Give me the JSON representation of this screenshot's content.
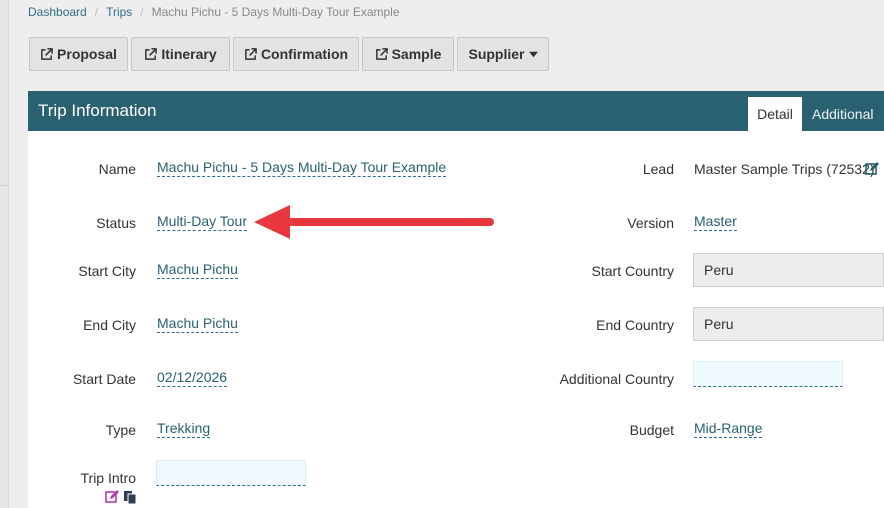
{
  "breadcrumb": {
    "items": [
      "Dashboard",
      "Trips",
      "Machu Pichu - 5 Days Multi-Day Tour Example"
    ]
  },
  "toolbar": {
    "proposal_label": "Proposal",
    "itinerary_label": "Itinerary",
    "confirmation_label": "Confirmation",
    "sample_label": "Sample",
    "supplier_label": "Supplier"
  },
  "panel": {
    "title": "Trip Information",
    "tabs": [
      "Detail",
      "Additional"
    ],
    "active_tab": "Detail",
    "header_color": "#2a6170"
  },
  "fields": {
    "name": {
      "label": "Name",
      "value": "Machu Pichu - 5 Days Multi-Day Tour Example"
    },
    "status": {
      "label": "Status",
      "value": "Multi-Day Tour"
    },
    "start_city": {
      "label": "Start City",
      "value": "Machu Pichu"
    },
    "end_city": {
      "label": "End City",
      "value": "Machu Pichu"
    },
    "start_date": {
      "label": "Start Date",
      "value": "02/12/2026"
    },
    "type": {
      "label": "Type",
      "value": "Trekking"
    },
    "trip_intro": {
      "label": "Trip Intro",
      "value": ""
    },
    "lead": {
      "label": "Lead",
      "value": "Master Sample Trips (72532)"
    },
    "version": {
      "label": "Version",
      "value": "Master"
    },
    "start_country": {
      "label": "Start Country",
      "value": "Peru"
    },
    "end_country": {
      "label": "End Country",
      "value": "Peru"
    },
    "additional_country": {
      "label": "Additional Country",
      "value": ""
    },
    "budget": {
      "label": "Budget",
      "value": "Mid-Range"
    }
  },
  "annotation": {
    "color": "#e8383d"
  }
}
